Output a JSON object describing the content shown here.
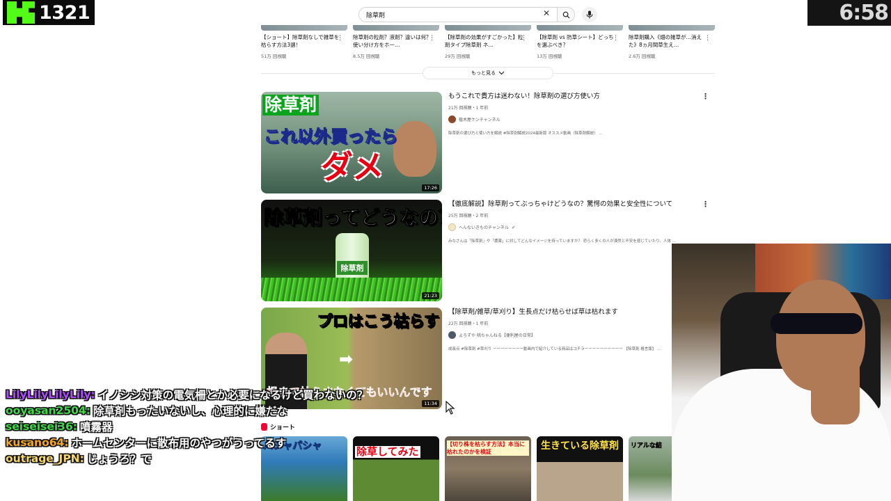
{
  "overlay": {
    "viewer_count": "1321",
    "timer": "6:58",
    "kick_green": "#53fc18"
  },
  "search": {
    "query": "除草剤",
    "clear_icon": "close-icon",
    "search_icon": "search-icon",
    "mic_icon": "mic-icon"
  },
  "top_row": [
    {
      "title": "【ショート】除草剤なしで雑草を枯らす方法3選！",
      "views": "51万 回視聴"
    },
    {
      "title": "除草剤の粒剤？液剤？違いは何？使い分け方をホー…",
      "views": "8.5万 回視聴"
    },
    {
      "title": "【除草剤の効果がすごかった】粒剤タイプ除草剤 ネ…",
      "views": "29万 回視聴"
    },
    {
      "title": "【除草剤 vs 防草シート】どっちを選ぶべき？",
      "views": "13万 回視聴"
    },
    {
      "title": "除草剤購入《畑の雑草が…消えた》8ヵ月間草生え…",
      "views": "2.6万 回視聴"
    }
  ],
  "more_button": "もっと見る",
  "videos": [
    {
      "title": "もうこれで貴方は迷わない！除草剤の選び方使い方",
      "meta": "21万 回視聴・1 年前",
      "channel": "植木屋ケンチャンネル",
      "desc": "除草剤の選び方と使い方を解説 #除草剤解説2024最新版 オススメ動画（除草剤解説） ...",
      "duration": "17:26",
      "thumb_text_1": "除草剤",
      "thumb_text_2": "これ以外買ったら",
      "thumb_text_3": "ダメ"
    },
    {
      "title": "【徹底解説】除草剤ってぶっちゃけどうなの？驚愕の効果と安全性について",
      "meta": "25万 回視聴・2 年前",
      "channel": "へんないきものチャンネル",
      "desc": "みなさんは「除草剤」や「農薬」に対してどんなイメージを持っていますか？ 恐らく多くの人が漠然と不安を感じていたり、人体 ...",
      "duration": "21:23",
      "thumb_text_1": "除草剤ってどうなの？",
      "thumb_text_2": "除草剤"
    },
    {
      "title": "【除草剤/雑草/草刈り】生長点だけ枯らせば草は枯れます",
      "meta": "22万 回視聴・1 年前",
      "channel": "よろずや 桃ちゃんねる【便利屋の日常】",
      "desc": "成長点 #除草剤 #草刈り ーーーーーーーー動画内で紹介している商品はコチラーーーーーーーーーー 【除草剤 格言版】 ...",
      "duration": "11:34",
      "thumb_text_1": "プロはこう枯らす",
      "thumb_text_2": "根まで枯らさなくてもいいんです"
    }
  ],
  "shorts": {
    "heading": "ショート",
    "items": [
      {
        "label": "パシャパシャ"
      },
      {
        "label": "除草してみた"
      },
      {
        "label": "【切り株を枯らす方法】本当に枯れたのかを検証"
      },
      {
        "label": "生きている除草剤"
      },
      {
        "label": "リアルな結"
      }
    ]
  },
  "chat": [
    {
      "user": "LilyLilyLilyLily:",
      "color": "#b04cff",
      "message": "イノシシ対策の電気柵とか必要になるけど買わないの？"
    },
    {
      "user": "ooyasan2504:",
      "color": "#3ed84a",
      "message": "除草剤もったいないし、心理的に嫌だな"
    },
    {
      "user": "seiseisei36:",
      "color": "#3ed84a",
      "message": "噴霧器"
    },
    {
      "user": "kusano64:",
      "color": "#f5a623",
      "message": "ホームセンターに散布用のやつがうってるす"
    },
    {
      "user": "outrage_JPN:",
      "color": "#f5d76e",
      "message": "じょうろ？で"
    }
  ]
}
